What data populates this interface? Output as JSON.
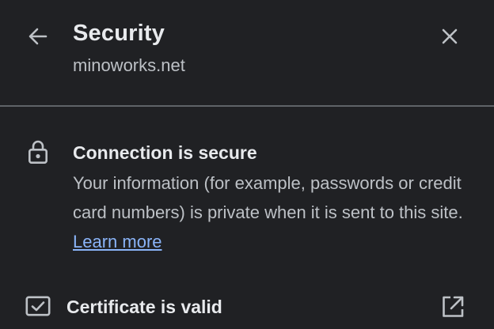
{
  "header": {
    "title": "Security",
    "domain": "minoworks.net",
    "back_icon": "arrow-left-icon",
    "close_icon": "close-icon"
  },
  "connection": {
    "icon": "lock-icon",
    "heading": "Connection is secure",
    "description": "Your information (for example, passwords or credit card numbers) is private when it is sent to this site.",
    "learn_more_label": "Learn more"
  },
  "certificate": {
    "icon": "certificate-check-icon",
    "label": "Certificate is valid",
    "action_icon": "external-link-icon"
  },
  "colors": {
    "background": "#202124",
    "primary_text": "#e8eaed",
    "secondary_text": "#bdc1c6",
    "link": "#8ab4f8",
    "divider": "#5f6368"
  }
}
